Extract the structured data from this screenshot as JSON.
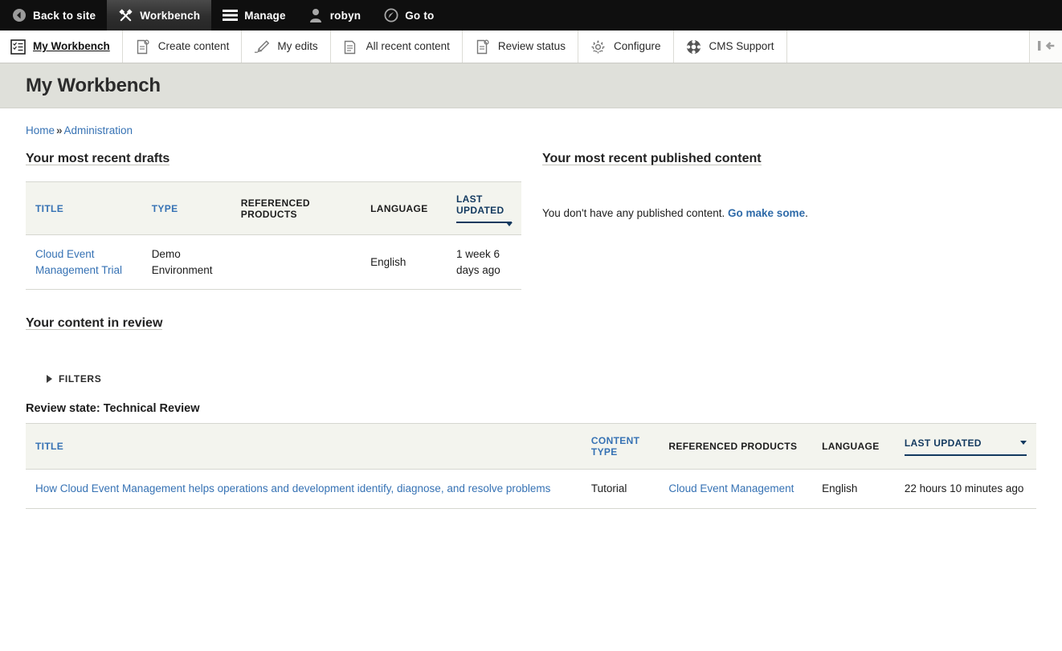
{
  "admin_bar": {
    "items": [
      {
        "label": "Back to site",
        "icon": "back-circle-icon",
        "active": false
      },
      {
        "label": "Workbench",
        "icon": "crossed-tools-icon",
        "active": true
      },
      {
        "label": "Manage",
        "icon": "hamburger-icon",
        "active": false
      },
      {
        "label": "robyn",
        "icon": "user-icon",
        "active": false
      },
      {
        "label": "Go to",
        "icon": "compass-icon",
        "active": false
      }
    ]
  },
  "tab_bar": {
    "tabs": [
      {
        "label": "My Workbench",
        "icon": "checklist-icon",
        "active": true
      },
      {
        "label": "Create content",
        "icon": "document-plus-icon",
        "active": false
      },
      {
        "label": "My edits",
        "icon": "pencil-icon",
        "active": false
      },
      {
        "label": "All recent content",
        "icon": "document-stack-icon",
        "active": false
      },
      {
        "label": "Review status",
        "icon": "document-check-icon",
        "active": false
      },
      {
        "label": "Configure",
        "icon": "gear-icon",
        "active": false
      },
      {
        "label": "CMS Support",
        "icon": "lifering-icon",
        "active": false
      }
    ],
    "collapse_icon": "collapse-toolbar-icon"
  },
  "page": {
    "title": "My Workbench"
  },
  "breadcrumb": {
    "items": [
      "Home",
      "Administration"
    ],
    "separator": "»"
  },
  "drafts": {
    "heading": "Your most recent drafts",
    "columns": [
      {
        "label": "TITLE",
        "style": "link"
      },
      {
        "label": "TYPE",
        "style": "link"
      },
      {
        "label": "REFERENCED PRODUCTS",
        "style": "plain"
      },
      {
        "label": "LANGUAGE",
        "style": "plain"
      },
      {
        "label": "LAST UPDATED",
        "style": "sorted"
      }
    ],
    "rows": [
      {
        "title": "Cloud Event Management Trial",
        "type": "Demo Environment",
        "referenced_products": "",
        "language": "English",
        "last_updated": "1 week 6 days ago"
      }
    ]
  },
  "published": {
    "heading": "Your most recent published content",
    "empty_text": "You don't have any published content.",
    "empty_link": "Go make some",
    "empty_suffix": "."
  },
  "review": {
    "heading": "Your content in review",
    "filters_label": "FILTERS",
    "state_label": "Review state: Technical Review",
    "columns": [
      {
        "label": "TITLE",
        "style": "link"
      },
      {
        "label": "CONTENT TYPE",
        "style": "link"
      },
      {
        "label": "REFERENCED PRODUCTS",
        "style": "plain"
      },
      {
        "label": "LANGUAGE",
        "style": "plain"
      },
      {
        "label": "LAST UPDATED",
        "style": "sorted"
      }
    ],
    "rows": [
      {
        "title": "How Cloud Event Management helps operations and development identify, diagnose, and resolve problems",
        "content_type": "Tutorial",
        "referenced_products": "Cloud Event Management",
        "language": "English",
        "last_updated": "22 hours 10 minutes ago"
      }
    ]
  },
  "colors": {
    "toolbar_bg": "#0f0f0f",
    "page_head_bg": "#dfe0da",
    "link_blue": "#3672b4",
    "header_navy": "#1d3f66",
    "table_header_bg": "#f3f4ee"
  }
}
